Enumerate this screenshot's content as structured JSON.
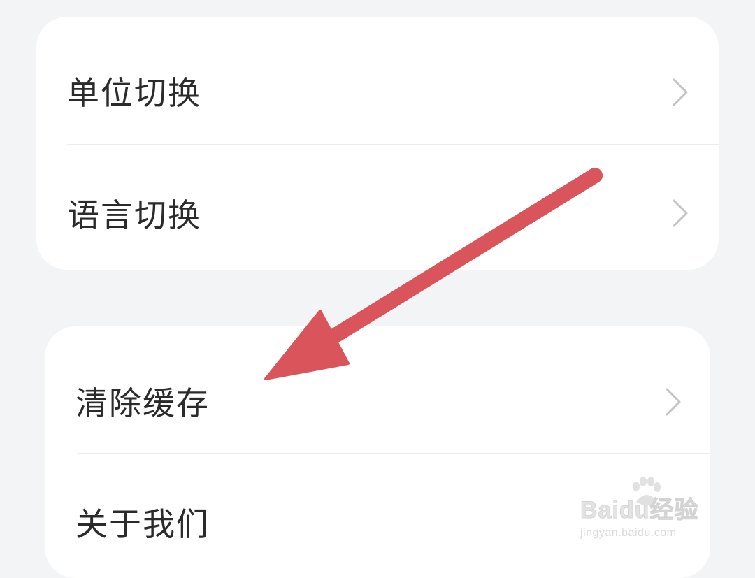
{
  "settings": {
    "group1": [
      {
        "label": "单位切换"
      },
      {
        "label": "语言切换"
      }
    ],
    "group2": [
      {
        "label": "清除缓存"
      },
      {
        "label": "关于我们"
      }
    ]
  },
  "annotation": {
    "arrow_color": "#d9545b"
  },
  "watermark": {
    "logo": "Baidu经验",
    "url": "jingyan.baidu.com"
  },
  "colors": {
    "background": "#f3f4f6",
    "card": "#ffffff",
    "text": "#2b2b2b",
    "chevron": "#c4c4c4"
  }
}
